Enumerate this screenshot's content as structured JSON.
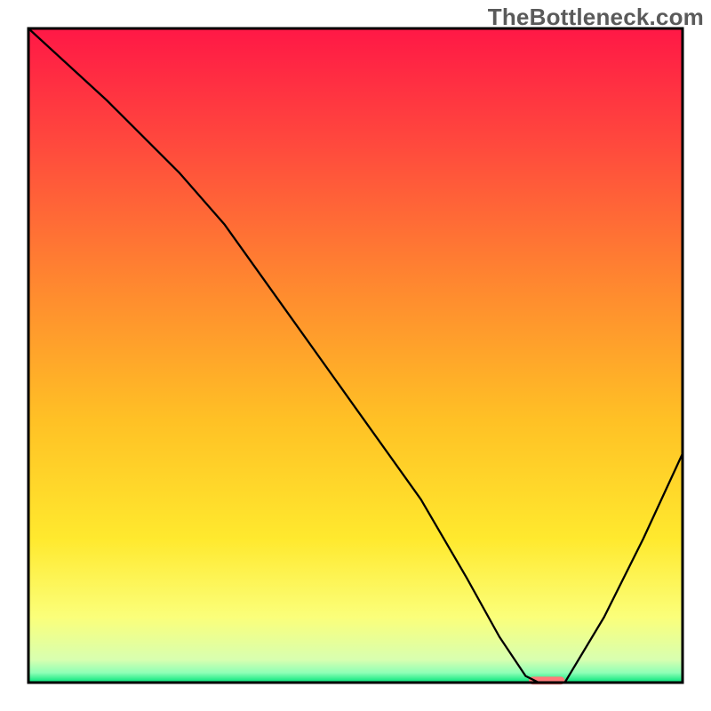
{
  "watermark": "TheBottleneck.com",
  "chart_data": {
    "type": "line",
    "title": "",
    "xlabel": "",
    "ylabel": "",
    "xlim": [
      0,
      100
    ],
    "ylim": [
      0,
      100
    ],
    "grid": false,
    "legend": false,
    "background_gradient": {
      "orientation": "vertical",
      "stops": [
        {
          "pos": 0.0,
          "color": "#ff1846"
        },
        {
          "pos": 0.18,
          "color": "#ff4a3d"
        },
        {
          "pos": 0.4,
          "color": "#ff8a2f"
        },
        {
          "pos": 0.6,
          "color": "#ffc125"
        },
        {
          "pos": 0.78,
          "color": "#ffe92e"
        },
        {
          "pos": 0.9,
          "color": "#fbff7a"
        },
        {
          "pos": 0.965,
          "color": "#d8ffb0"
        },
        {
          "pos": 0.985,
          "color": "#8fffb6"
        },
        {
          "pos": 1.0,
          "color": "#00e47a"
        }
      ]
    },
    "series": [
      {
        "name": "bottleneck-curve",
        "color": "#000000",
        "stroke_width": 2,
        "x": [
          0,
          12,
          23,
          30,
          40,
          50,
          60,
          67,
          72,
          76,
          78,
          82,
          88,
          94,
          100
        ],
        "values": [
          100,
          89,
          78,
          70,
          56,
          42,
          28,
          16,
          7,
          1,
          0,
          0,
          10,
          22,
          35
        ]
      }
    ],
    "marker": {
      "name": "optimal-range",
      "shape": "capsule",
      "color": "#ff7a7a",
      "x_start": 76.5,
      "x_end": 82.0,
      "y": 0,
      "height_pct": 1.2
    }
  }
}
